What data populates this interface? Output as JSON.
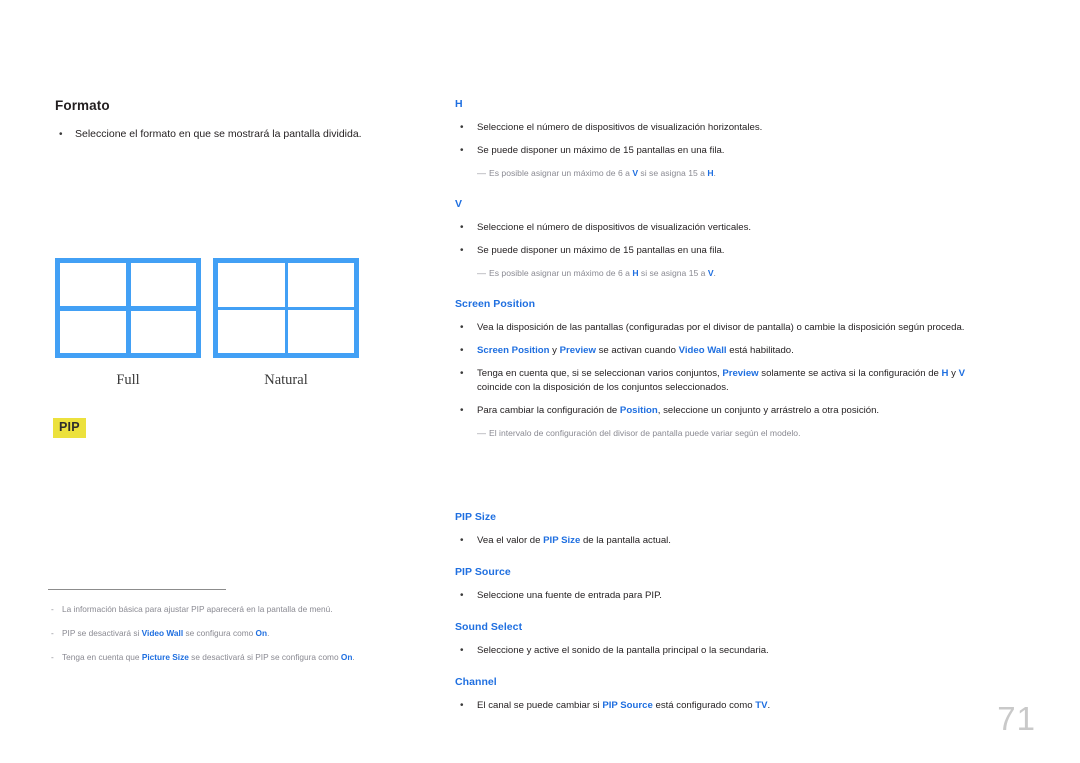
{
  "page": {
    "number": "71"
  },
  "left": {
    "section_title": "Formato",
    "bullets": [
      {
        "marker": "•",
        "text": "Seleccione el formato en que se mostrará la pantalla dividida."
      }
    ],
    "diagrams": [
      {
        "label": "Full",
        "type": "grid-2x2",
        "inner_divider": "thick"
      },
      {
        "label": "Natural",
        "type": "grid-2x2",
        "inner_divider": "thin"
      }
    ],
    "pip_badge": "PIP",
    "footnotes": [
      {
        "marker": "-",
        "text": "La información básica para ajustar PIP aparecerá en la pantalla de menú."
      },
      {
        "marker": "-",
        "pre": "PIP se desactivará si ",
        "hl1": "Video Wall",
        "mid": " se configura como ",
        "hl2": "On",
        "post": "."
      },
      {
        "marker": "-",
        "pre": "Tenga en cuenta que ",
        "hl1": "Picture Size",
        "mid": " se desactivará si PIP se configura como ",
        "hl2": "On",
        "post": "."
      }
    ]
  },
  "right": {
    "sections": [
      {
        "heading": "H",
        "bullets": [
          {
            "marker": "•",
            "text": "Seleccione el número de dispositivos de visualización horizontales."
          },
          {
            "marker": "•",
            "text": "Se puede disponer un máximo de 15 pantallas en una fila."
          }
        ],
        "note": {
          "marker": "—",
          "pre": "Es posible asignar un máximo de 6 a ",
          "hl1": "V",
          "mid": " si se asigna 15 a ",
          "hl2": "H",
          "post": "."
        }
      },
      {
        "heading": "V",
        "bullets": [
          {
            "marker": "•",
            "text": "Seleccione el número de dispositivos de visualización verticales."
          },
          {
            "marker": "•",
            "text": "Se puede disponer un máximo de 15 pantallas en una fila."
          }
        ],
        "note": {
          "marker": "—",
          "pre": "Es posible asignar un máximo de 6 a ",
          "hl1": "H",
          "mid": " si se asigna 15 a ",
          "hl2": "V",
          "post": "."
        }
      }
    ],
    "screen_position": {
      "heading": "Screen Position",
      "bullet1": "Vea la disposición de las pantallas (configuradas por el divisor de pantalla) o cambie la disposición según proceda.",
      "bullet2": {
        "hl1": "Screen Position",
        "mid1": " y ",
        "hl2": "Preview",
        "mid2": " se activan cuando ",
        "hl3": "Video Wall",
        "post": " está habilitado."
      },
      "bullet3": {
        "pre": "Tenga en cuenta que, si se seleccionan varios conjuntos, ",
        "hl1": "Preview",
        "mid1": " solamente se activa si la configuración de ",
        "hl2": "H",
        "mid2": " y ",
        "hl3": "V",
        "post": " coincide con la disposición de los conjuntos seleccionados."
      },
      "bullet4": {
        "pre": "Para cambiar la configuración de ",
        "hl1": "Position",
        "post": ", seleccione un conjunto y arrástrelo a otra posición."
      },
      "note": {
        "marker": "—",
        "text": "El intervalo de configuración del divisor de pantalla puede variar según el modelo."
      }
    },
    "pip_size": {
      "heading": "PIP Size",
      "bullet": {
        "pre": "Vea el valor de ",
        "hl1": "PIP Size",
        "post": " de la pantalla actual."
      }
    },
    "pip_source": {
      "heading": "PIP Source",
      "bullet": "Seleccione una fuente de entrada para PIP."
    },
    "sound_select": {
      "heading": "Sound Select",
      "bullet": "Seleccione y active el sonido de la pantalla principal o la secundaria."
    },
    "channel": {
      "heading": "Channel",
      "bullet": {
        "pre": "El canal se puede cambiar si ",
        "hl1": "PIP Source",
        "mid": " está configurado como ",
        "hl2": "TV",
        "post": "."
      }
    }
  },
  "colors": {
    "accent_blue": "#1f6fe0",
    "diagram_blue": "#42a0f5",
    "badge_yellow": "#ece13d",
    "note_gray": "#8a8a92",
    "page_number_gray": "#c9c9c9"
  }
}
